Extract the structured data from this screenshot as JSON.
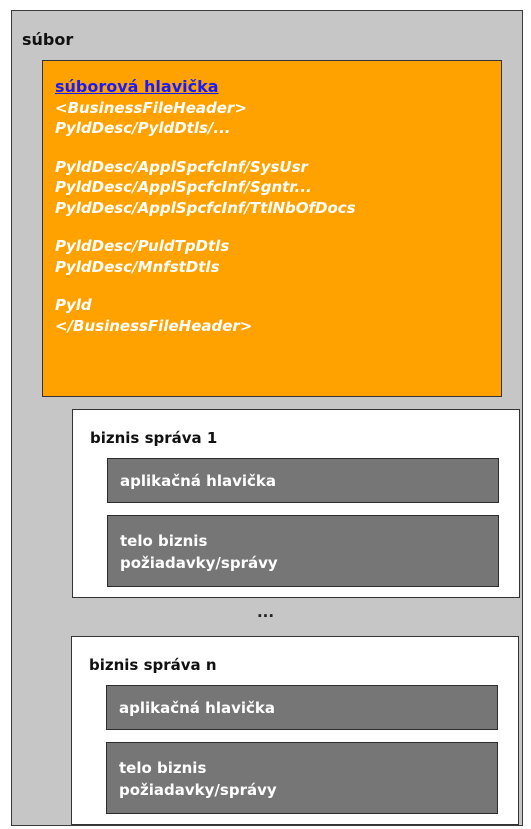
{
  "file_label": "súbor",
  "file_header": {
    "title": "súborová hlavička",
    "lines": [
      "<BusinessFileHeader>",
      "PyldDesc/PyldDtls/...",
      "PyldDesc/ApplSpcfcInf/SysUsr",
      "PyldDesc/ApplSpcfcInf/Sgntr...",
      "PyldDesc/ApplSpcfcInf/TtlNbOfDocs",
      "PyldDesc/PuldTpDtls",
      "PyldDesc/MnfstDtls",
      "Pyld",
      "</BusinessFileHeader>"
    ]
  },
  "messages": [
    {
      "title": "biznis správa 1",
      "app_header": "aplikačná hlavička",
      "body_line1": "telo biznis",
      "body_line2": "požiadavky/správy"
    },
    {
      "title": "biznis správa n",
      "app_header": "aplikačná hlavička",
      "body_line1": "telo biznis",
      "body_line2": "požiadavky/správy"
    }
  ],
  "ellipsis": "..."
}
